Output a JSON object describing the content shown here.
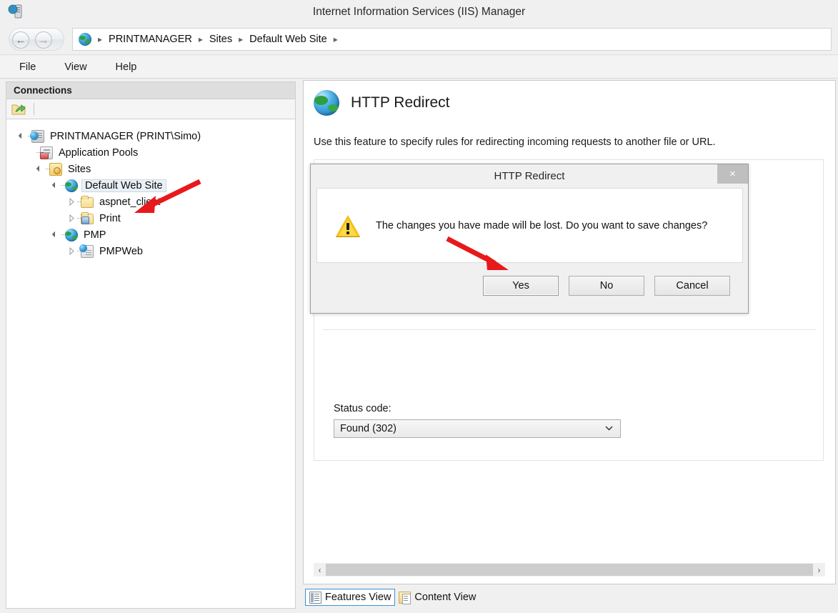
{
  "window": {
    "title": "Internet Information Services (IIS) Manager",
    "icon": "iis-server-icon"
  },
  "nav": {
    "back_icon": "back-arrow-icon",
    "forward_icon": "forward-arrow-icon",
    "address_icon": "globe-icon",
    "breadcrumb": [
      "PRINTMANAGER",
      "Sites",
      "Default Web Site"
    ],
    "separator": "▸"
  },
  "menu": {
    "items": [
      "File",
      "View",
      "Help"
    ]
  },
  "connections": {
    "header": "Connections",
    "toolbar_icon": "connect-to-server-icon",
    "tree": [
      {
        "label": "PRINTMANAGER (PRINT\\Simo)",
        "icon": "server-icon",
        "depth": 0,
        "expander": "open",
        "selected": false
      },
      {
        "label": "Application Pools",
        "icon": "app-pools-icon",
        "depth": 1,
        "expander": "none",
        "selected": false
      },
      {
        "label": "Sites",
        "icon": "sites-folder-icon",
        "depth": 1,
        "expander": "open",
        "selected": false
      },
      {
        "label": "Default Web Site",
        "icon": "website-icon",
        "depth": 2,
        "expander": "open",
        "selected": true
      },
      {
        "label": "aspnet_client",
        "icon": "folder-icon",
        "depth": 3,
        "expander": "closed",
        "selected": false
      },
      {
        "label": "Print",
        "icon": "application-folder-icon",
        "depth": 3,
        "expander": "closed",
        "selected": false
      },
      {
        "label": "PMP",
        "icon": "website-icon",
        "depth": 2,
        "expander": "open",
        "selected": false
      },
      {
        "label": "PMPWeb",
        "icon": "application-icon",
        "depth": 3,
        "expander": "closed",
        "selected": false
      }
    ]
  },
  "feature": {
    "icon": "http-redirect-icon",
    "title": "HTTP Redirect",
    "description": "Use this feature to specify rules for redirecting incoming requests to another file or URL.",
    "status_code_label": "Status code:",
    "status_code_value": "Found (302)",
    "status_code_caret": "⌄"
  },
  "scrollbar": {
    "left_arrow": "‹",
    "right_arrow": "›"
  },
  "view_tabs": [
    {
      "label": "Features View",
      "icon": "features-view-icon",
      "active": true
    },
    {
      "label": "Content View",
      "icon": "content-view-icon",
      "active": false
    }
  ],
  "dialog": {
    "title": "HTTP Redirect",
    "close_label": "×",
    "warning_icon": "warning-triangle-icon",
    "message": "The changes you have made will be lost. Do you want to save changes?",
    "buttons": [
      {
        "label": "Yes",
        "default": true
      },
      {
        "label": "No",
        "default": false
      },
      {
        "label": "Cancel",
        "default": false
      }
    ]
  },
  "annotations": {
    "arrow_color": "#e8191b",
    "arrows": [
      {
        "name": "arrow-pointing-to-print-node"
      },
      {
        "name": "arrow-pointing-to-yes-button"
      }
    ]
  }
}
